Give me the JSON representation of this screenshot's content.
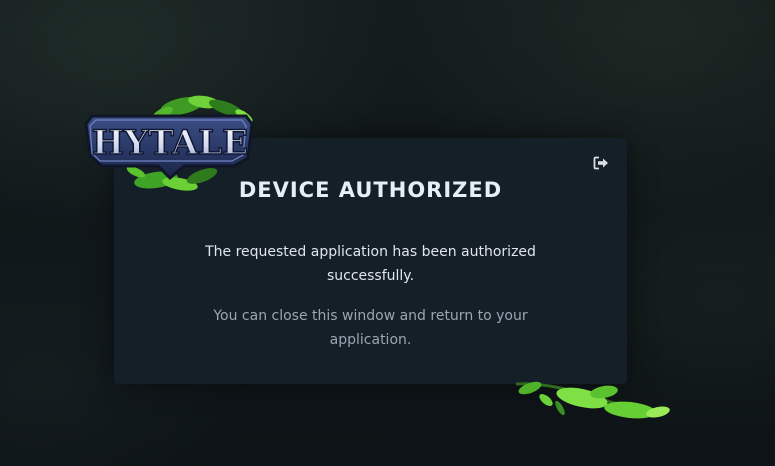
{
  "logo": {
    "text": "HYTALE"
  },
  "card": {
    "title": "DEVICE AUTHORIZED",
    "message_primary": "The requested application has been authorized successfully.",
    "message_secondary": "You can close this window and return to your application."
  },
  "icons": {
    "logout": "sign-out-icon"
  },
  "colors": {
    "background": "#10171a",
    "card": "#151f28",
    "title": "#e6eef6",
    "text_primary": "#dfe6ec",
    "text_secondary": "#9aa6b1",
    "leaf_green": "#5fc934"
  }
}
